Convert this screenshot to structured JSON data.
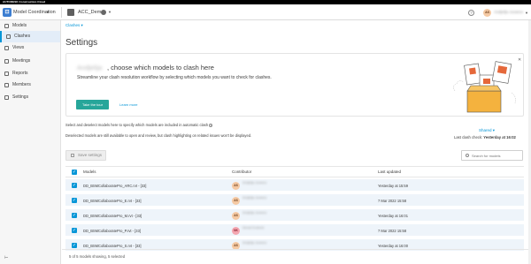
{
  "topbar": {
    "brand": "AUTODESK Construction Cloud"
  },
  "header": {
    "app_name": "Model Coordination",
    "project_name": "ACC_Demo",
    "user_initials": "AS",
    "user_name": "Andjelija Jovanov"
  },
  "sidebar": {
    "items": [
      {
        "label": "Models",
        "active": false
      },
      {
        "label": "Clashes",
        "active": true
      },
      {
        "label": "Views",
        "active": false
      },
      {
        "label": "Meetings",
        "active": false
      },
      {
        "label": "Reports",
        "active": false
      },
      {
        "label": "Members",
        "active": false
      },
      {
        "label": "Settings",
        "active": false
      }
    ],
    "collapse": "⊢"
  },
  "main": {
    "breadcrumb": "Clashes ▾",
    "title": "Settings"
  },
  "banner": {
    "user_name": "Andjelija",
    "title": ", choose which models to clash here",
    "subtitle": "Streamline your clash resolution workflow by selecting which models you want to check for clashes.",
    "tour_button": "Take the tour",
    "learn_link": "Learn more",
    "close": "✕"
  },
  "info": {
    "line1": "Select and deselect models here to specify which models are included in automatic clash",
    "line2": "Deselected models are still available to open and review, but clash highlighting on related issues won't be displayed.",
    "shared": "Shared ▾",
    "last_check_label": "Last clash check:",
    "last_check_value": "Yesterday at 16:02"
  },
  "toolbar": {
    "save_label": "Save settings",
    "search_placeholder": "Search for models"
  },
  "table": {
    "headers": {
      "models": "Models",
      "contributor": "Contributor",
      "last_updated": "Last updated"
    },
    "rows": [
      {
        "name": "DD_BSMCollaboratePro_ARC.rvt - [33]",
        "initials": "AS",
        "contributor": "Andjelija Jovanov",
        "updated": "Yesterday at 15:59",
        "avatar_color": "#f5c9a3"
      },
      {
        "name": "DD_BSMCollaboratePro_E.rvt - [33]",
        "initials": "AS",
        "contributor": "Andjelija Jovanov",
        "updated": "7 Mar 2022 15:58",
        "avatar_color": "#f5c9a3"
      },
      {
        "name": "DD_BSMCollaboratePro_M.rvt - [33]",
        "initials": "AS",
        "contributor": "Andjelija Jovanov",
        "updated": "Yesterday at 16:01",
        "avatar_color": "#f5c9a3"
      },
      {
        "name": "DD_BSMCollaboratePro_P.rvt - [33]",
        "initials": "NK",
        "contributor": "Nenad Kostovic",
        "updated": "7 Mar 2022 15:58",
        "avatar_color": "#f4a6b0"
      },
      {
        "name": "DD_BSMCollaboratePro_S.rvt - [33]",
        "initials": "AS",
        "contributor": "Andjelija Jovanov",
        "updated": "Yesterday at 16:00",
        "avatar_color": "#f5c9a3"
      }
    ]
  },
  "footer": {
    "text": "5 of 5 models showing, 5 selected"
  },
  "colors": {
    "accent": "#0696d7",
    "tour_button": "#26a69a",
    "row_bg": "#eef4fa"
  }
}
